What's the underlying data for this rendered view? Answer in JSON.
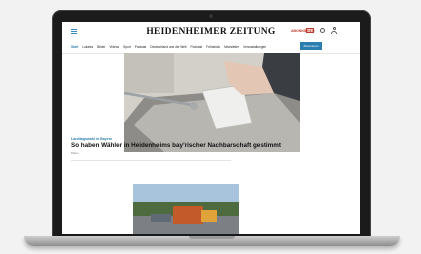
{
  "site": {
    "logo": "HEIDENHEIMER ZEITUNG",
    "subscribe_label": "ABONNIEREN",
    "nav_items": [
      "Start",
      "Lokales",
      "Bilder",
      "Videos",
      "Sport",
      "Podcast",
      "Deutschland und die Welt",
      "Podcast",
      "Frühstück",
      "Newsletter",
      "Veranstaltungen"
    ],
    "nav_button": "Abonnieren"
  },
  "article": {
    "kicker": "Landtagswahl in Bayern",
    "headline": "So haben Wähler in Heidenheims bay’rischer Nachbarschaft gestimmt",
    "byline": "Piano"
  },
  "colors": {
    "accent": "#2b7fb0",
    "brand_red": "#c03a2b"
  }
}
